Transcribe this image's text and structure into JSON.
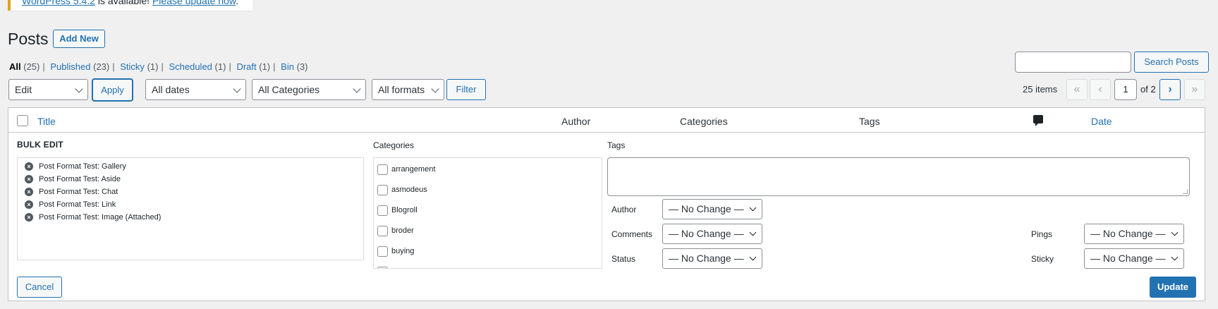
{
  "notice": {
    "link_version": "WordPress 5.4.2",
    "middle_text": " is available! ",
    "link_update": "Please update now",
    "end_text": "."
  },
  "header": {
    "title": "Posts",
    "add_new": "Add New"
  },
  "views": [
    {
      "label": "All",
      "count": "(25)"
    },
    {
      "label": "Published",
      "count": "(23)"
    },
    {
      "label": "Sticky",
      "count": "(1)"
    },
    {
      "label": "Scheduled",
      "count": "(1)"
    },
    {
      "label": "Draft",
      "count": "(1)"
    },
    {
      "label": "Bin",
      "count": "(3)"
    }
  ],
  "search": {
    "button": "Search Posts",
    "value": ""
  },
  "toolbar": {
    "bulk_action": "Edit",
    "apply": "Apply",
    "dates": "All dates",
    "categories": "All Categories",
    "formats": "All formats",
    "filter": "Filter"
  },
  "pagination": {
    "items": "25 items",
    "first": "«",
    "prev": "‹",
    "current": "1",
    "of": "of 2",
    "next": "›",
    "last": "»"
  },
  "table": {
    "columns": {
      "title": "Title",
      "author": "Author",
      "categories": "Categories",
      "tags": "Tags",
      "date": "Date"
    }
  },
  "bulk_edit": {
    "title": "BULK EDIT",
    "posts": [
      "Post Format Test: Gallery",
      "Post Format Test: Aside",
      "Post Format Test: Chat",
      "Post Format Test: Link",
      "Post Format Test: Image (Attached)"
    ],
    "remove_glyph": "×",
    "categories_label": "Categories",
    "categories": [
      "arrangement",
      "asmodeus",
      "Blogroll",
      "broder",
      "buying"
    ],
    "tags_label": "Tags",
    "fields": {
      "author": {
        "label": "Author",
        "value": "— No Change —"
      },
      "comments": {
        "label": "Comments",
        "value": "— No Change —"
      },
      "status": {
        "label": "Status",
        "value": "— No Change —"
      },
      "pings": {
        "label": "Pings",
        "value": "— No Change —"
      },
      "sticky": {
        "label": "Sticky",
        "value": "— No Change —"
      }
    },
    "cancel": "Cancel",
    "update": "Update"
  },
  "colors": {
    "accent": "#2271b1",
    "background": "#f0f0f1",
    "notice_border": "#dba617"
  },
  "icons": {
    "comment_column": "comment-bubble-icon",
    "remove": "remove-circle-icon",
    "dropdown": "chevron-down-icon"
  }
}
